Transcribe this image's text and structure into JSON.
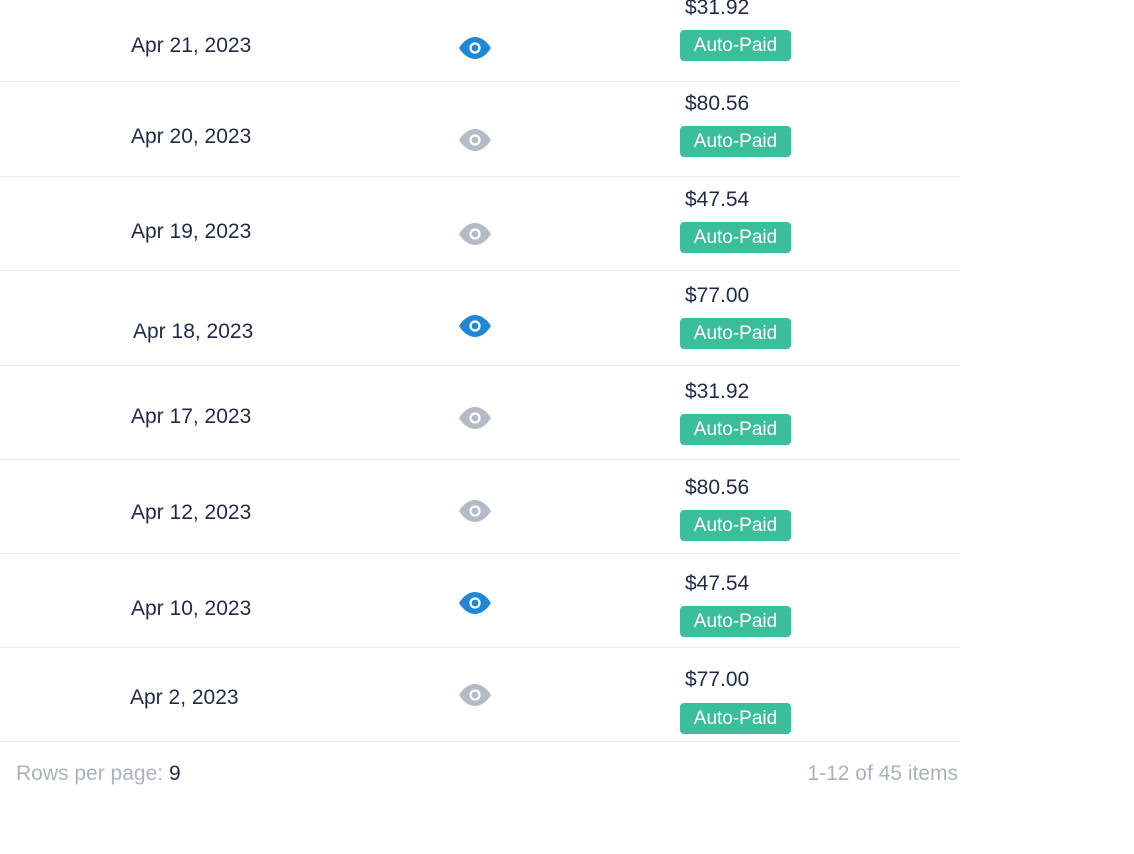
{
  "rows": [
    {
      "date": "Apr 21, 2023",
      "amount": "$31.92",
      "status": "Auto-Paid",
      "viewed": true
    },
    {
      "date": "Apr 20, 2023",
      "amount": "$80.56",
      "status": "Auto-Paid",
      "viewed": false
    },
    {
      "date": "Apr 19, 2023",
      "amount": "$47.54",
      "status": "Auto-Paid",
      "viewed": false
    },
    {
      "date": "Apr 18, 2023",
      "amount": "$77.00",
      "status": "Auto-Paid",
      "viewed": true
    },
    {
      "date": "Apr 17, 2023",
      "amount": "$31.92",
      "status": "Auto-Paid",
      "viewed": false
    },
    {
      "date": "Apr 12, 2023",
      "amount": "$80.56",
      "status": "Auto-Paid",
      "viewed": false
    },
    {
      "date": "Apr 10, 2023",
      "amount": "$47.54",
      "status": "Auto-Paid",
      "viewed": true
    },
    {
      "date": "Apr 2, 2023",
      "amount": "$77.00",
      "status": "Auto-Paid",
      "viewed": false
    }
  ],
  "icons": {
    "view": "eye-icon"
  },
  "colors": {
    "eye_active": "#1e88d6",
    "eye_inactive": "#b4bac6",
    "badge": "#3bbf9b",
    "text": "#1f2a4a",
    "muted": "#aab1bf"
  },
  "footer": {
    "rows_per_page_label": "Rows per page:",
    "rows_per_page_value": "9",
    "range_text": "1-12 of 45 items"
  }
}
